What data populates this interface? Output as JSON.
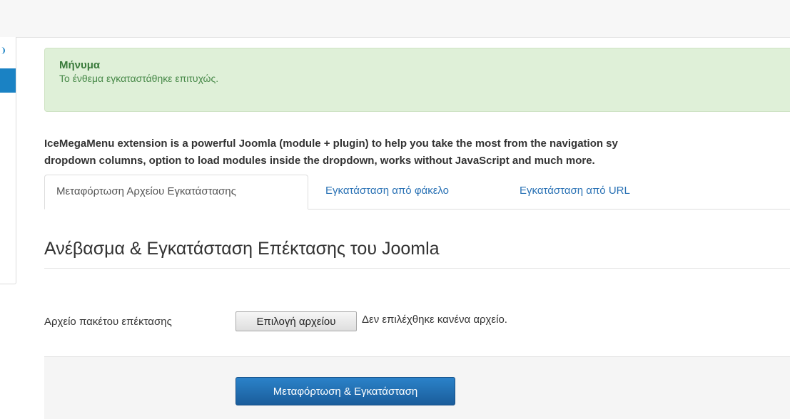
{
  "alert": {
    "heading": "Μήνυμα",
    "message": "Το ένθεμα εγκαταστάθηκε επιτυχώς."
  },
  "description": {
    "line1": "IceMegaMenu extension is a powerful Joomla (module + plugin) to help you take the most from the navigation sy",
    "line2": "dropdown columns, option to load modules inside the dropdown, works without JavaScript and much more."
  },
  "tabs": [
    {
      "label": "Μεταφόρτωση Αρχείου Εγκατάστασης",
      "active": true
    },
    {
      "label": "Εγκατάσταση από φάκελο",
      "active": false
    },
    {
      "label": "Εγκατάσταση από URL",
      "active": false
    }
  ],
  "section": {
    "title": "Ανέβασμα & Εγκατάσταση Επέκτασης του Joomla"
  },
  "form": {
    "package_label": "Αρχείο πακέτου επέκτασης",
    "file_button": "Επιλογή αρχείου",
    "file_status": "Δεν επιλέχθηκε κανένα αρχείο.",
    "submit_label": "Μεταφόρτωση & Εγκατάσταση"
  },
  "colors": {
    "accent": "#1a82c4",
    "alert_bg": "#dff0d8",
    "alert_text": "#468847",
    "link": "#2a72b5",
    "primary_button": "#1f6db0"
  }
}
